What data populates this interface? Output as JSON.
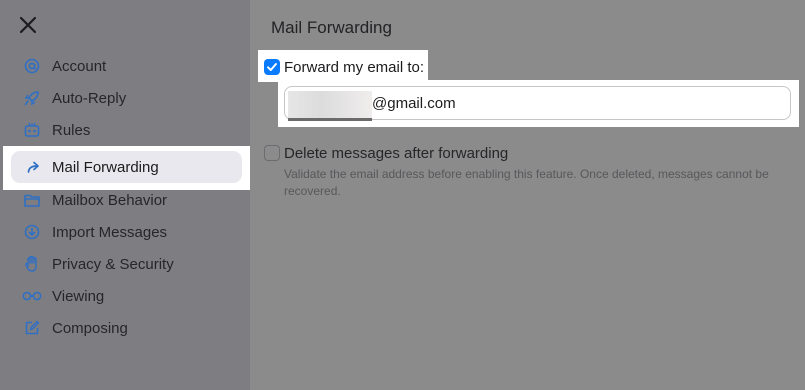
{
  "sidebar": {
    "items": [
      {
        "label": "Account",
        "icon": "at-icon"
      },
      {
        "label": "Auto-Reply",
        "icon": "rocket-icon"
      },
      {
        "label": "Rules",
        "icon": "robot-icon"
      },
      {
        "label": "Mail Forwarding",
        "icon": "forward-arrow-icon",
        "active": true
      },
      {
        "label": "Mailbox Behavior",
        "icon": "folder-icon"
      },
      {
        "label": "Import Messages",
        "icon": "download-icon"
      },
      {
        "label": "Privacy & Security",
        "icon": "hand-icon"
      },
      {
        "label": "Viewing",
        "icon": "glasses-icon"
      },
      {
        "label": "Composing",
        "icon": "compose-icon"
      }
    ]
  },
  "main": {
    "title": "Mail Forwarding",
    "forward_label": "Forward my email to:",
    "forward_checked": true,
    "forward_email": "@gmail.com",
    "delete_label": "Delete messages after forwarding",
    "delete_checked": false,
    "helper_text": "Validate the email address before enabling this feature. Once deleted, messages cannot be recovered."
  },
  "colors": {
    "accent": "#0a7aff",
    "icon": "#2f6fc4",
    "highlight": "#ffffff"
  }
}
